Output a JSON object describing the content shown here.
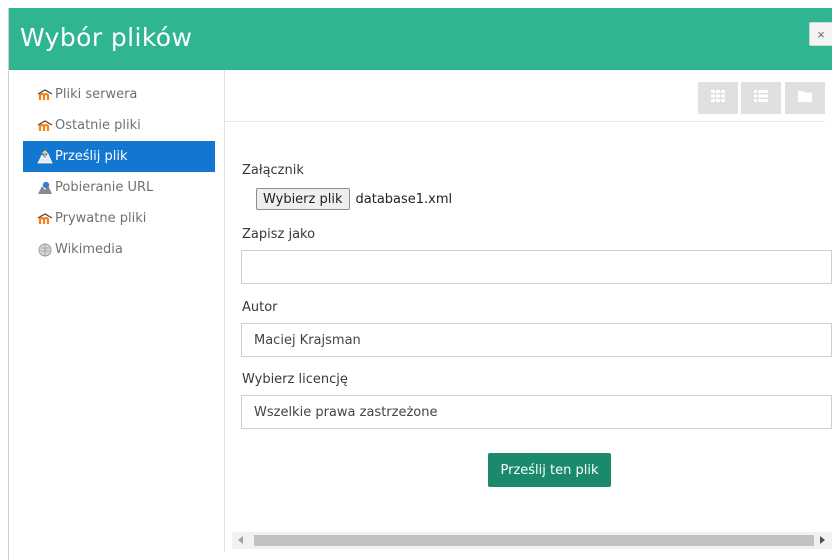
{
  "dialog": {
    "title": "Wybór plików",
    "close_label": "×"
  },
  "sidebar": {
    "items": [
      {
        "label": "Pliki serwera",
        "icon": "moodle-icon",
        "active": false
      },
      {
        "label": "Ostatnie pliki",
        "icon": "moodle-icon",
        "active": false
      },
      {
        "label": "Prześlij plik",
        "icon": "upload-icon",
        "active": true
      },
      {
        "label": "Pobieranie URL",
        "icon": "url-download-icon",
        "active": false
      },
      {
        "label": "Prywatne pliki",
        "icon": "moodle-icon",
        "active": false
      },
      {
        "label": "Wikimedia",
        "icon": "wikimedia-icon",
        "active": false
      }
    ]
  },
  "toolbar": {
    "views": [
      "grid-view-icon",
      "list-view-icon",
      "folder-view-icon"
    ]
  },
  "form": {
    "attachment_label": "Załącznik",
    "choose_button": "Wybierz plik",
    "file_name": "database1.xml",
    "save_as_label": "Zapisz jako",
    "save_as_value": "",
    "author_label": "Autor",
    "author_value": "Maciej Krajsman",
    "license_label": "Wybierz licencję",
    "license_value": "Wszelkie prawa zastrzeżone",
    "submit_label": "Prześlij ten plik"
  },
  "colors": {
    "header": "#2fb592",
    "active_item": "#1177d1",
    "submit": "#1b8a6c"
  }
}
